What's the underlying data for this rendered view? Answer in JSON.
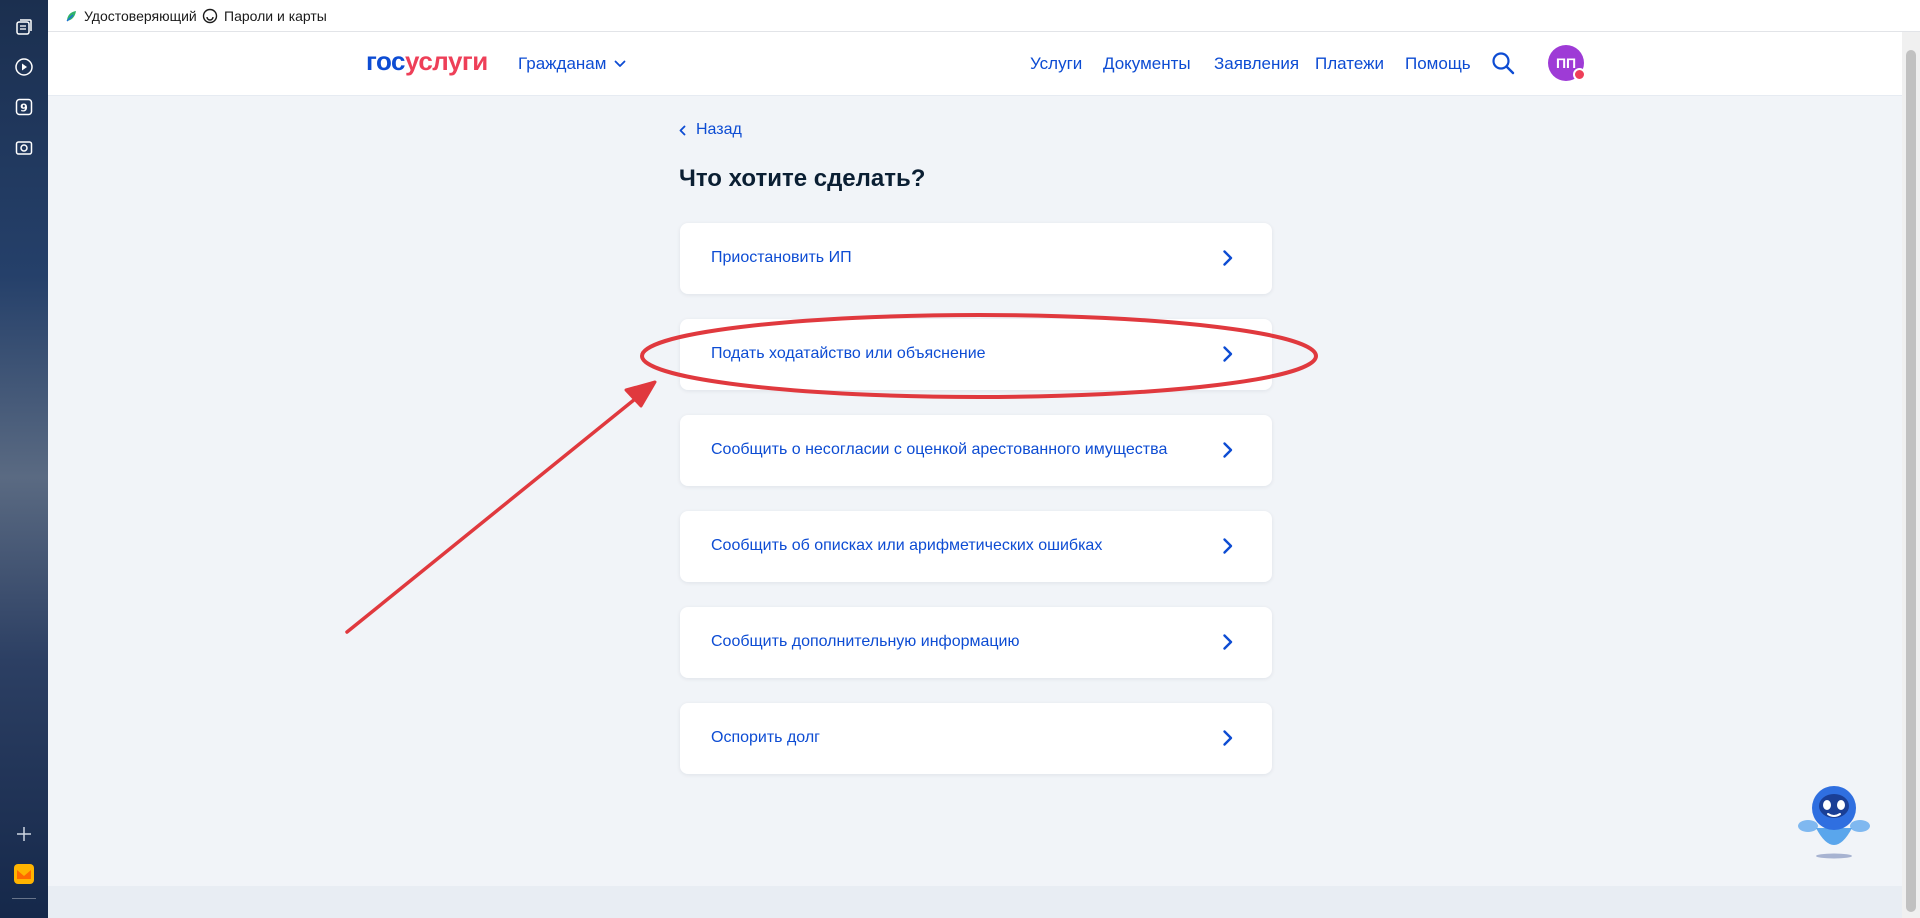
{
  "bookmarks": [
    {
      "label": "Удостоверяющий"
    },
    {
      "label": "Пароли и карты"
    }
  ],
  "header": {
    "logo_part1": "гос",
    "logo_part2": "услуги",
    "audience": "Гражданам",
    "nav": [
      "Услуги",
      "Документы",
      "Заявления",
      "Платежи",
      "Помощь"
    ],
    "avatar_initials": "ПП"
  },
  "content": {
    "back_label": "Назад",
    "title": "Что хотите сделать?",
    "options": [
      {
        "label": "Приостановить ИП"
      },
      {
        "label": "Подать ходатайство или объяснение"
      },
      {
        "label": "Сообщить о несогласии с оценкой арестованного имущества"
      },
      {
        "label": "Сообщить об описках или арифметических ошибках"
      },
      {
        "label": "Сообщить дополнительную информацию"
      },
      {
        "label": "Оспорить долг"
      }
    ]
  },
  "sidebar_icons": [
    "collections-icon",
    "video-icon",
    "badge-9-icon",
    "screenshot-icon",
    "add-icon",
    "mail-icon"
  ],
  "colors": {
    "accent": "#0d4cd3",
    "logo_red": "#ee3f58",
    "annotation_red": "#e0393e",
    "avatar": "#9e3bd6"
  }
}
